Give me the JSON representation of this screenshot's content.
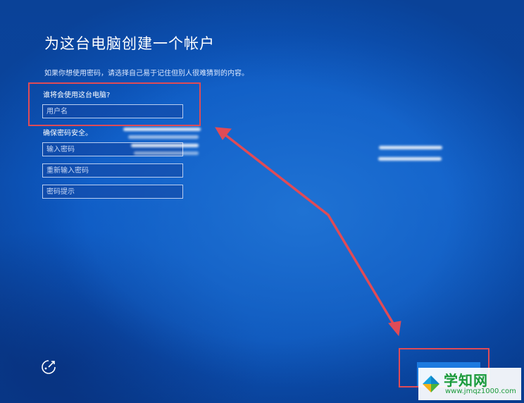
{
  "page": {
    "title": "为这台电脑创建一个帐户",
    "description": "如果你想使用密码，请选择自己易于记住但别人很难猜到的内容。"
  },
  "user_section": {
    "label": "谁将会使用这台电脑?",
    "username_placeholder": "用户名"
  },
  "password_section": {
    "label": "确保密码安全。",
    "password_placeholder": "输入密码",
    "reenter_placeholder": "重新输入密码",
    "hint_placeholder": "密码提示"
  },
  "annotations": {
    "highlight_color": "#e04b56"
  },
  "icons": {
    "accessibility": "ease-of-access-icon",
    "watermark_logo": "windows-logo-icon"
  },
  "watermark": {
    "name": "学知网",
    "url": "www.jmqz1000.com"
  },
  "theme": {
    "background": "#0e5cc7",
    "accent": "#1c7ae0",
    "text": "#ffffff"
  }
}
